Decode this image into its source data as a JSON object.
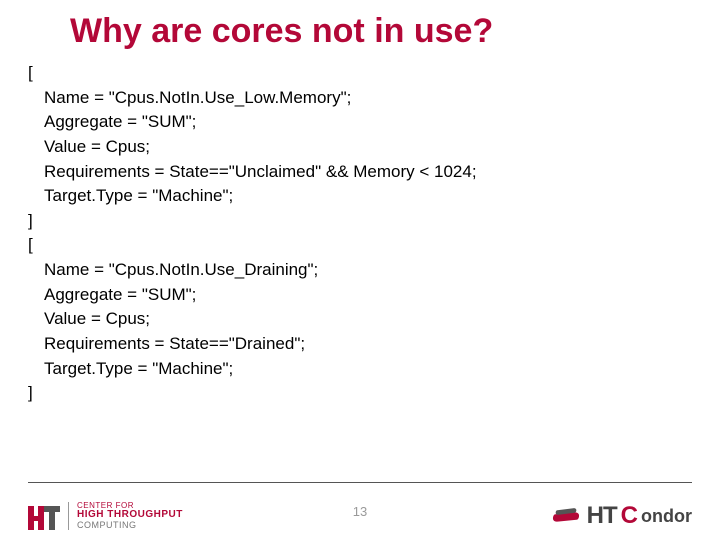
{
  "title": "Why are cores not in use?",
  "code": {
    "b1_open": "[",
    "b1_l1": "Name   = \"Cpus.NotIn.Use_Low.Memory\";",
    "b1_l2": "Aggregate = \"SUM\";",
    "b1_l3": "Value  = Cpus;",
    "b1_l4": "Requirements = State==\"Unclaimed\" && Memory < 1024;",
    "b1_l5": "Target.Type = \"Machine\";",
    "b1_close": "]",
    "b2_open": "[",
    "b2_l1": "Name   = \"Cpus.NotIn.Use_Draining\";",
    "b2_l2": "Aggregate = \"SUM\";",
    "b2_l3": "Value  = Cpus;",
    "b2_l4": "Requirements = State==\"Drained\";",
    "b2_l5": "Target.Type = \"Machine\";",
    "b2_close": "]"
  },
  "page_number": "13",
  "footer": {
    "left_small": "CENTER FOR",
    "left_big": "HIGH THROUGHPUT",
    "left_sub": "COMPUTING",
    "right_ht": "HT",
    "right_c": "C",
    "right_rest": "ondor"
  }
}
